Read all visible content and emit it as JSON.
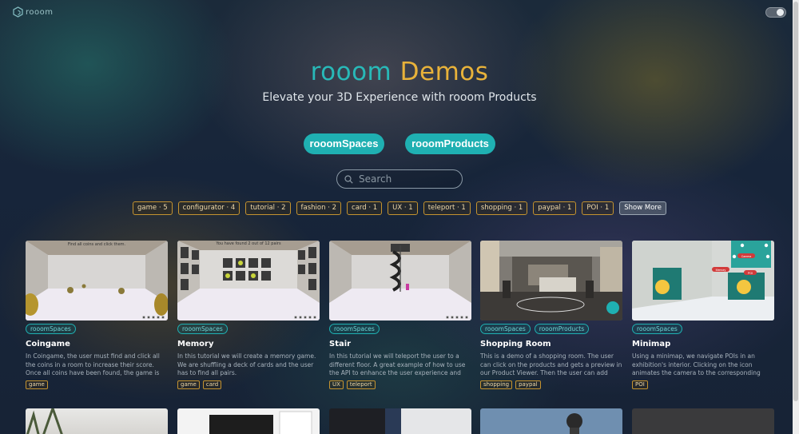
{
  "brand": {
    "logo_text": "rooom",
    "logo_icon": "rooom-cube-icon"
  },
  "theme_toggle": {
    "icon": "moon-icon"
  },
  "hero": {
    "title_part1": "rooom",
    "title_part2": "Demos",
    "subtitle": "Elevate your 3D Experience with rooom Products"
  },
  "categories": [
    {
      "label": "rooomSpaces"
    },
    {
      "label": "rooomProducts"
    }
  ],
  "search": {
    "placeholder": "Search",
    "icon": "search-icon"
  },
  "filter_tags": [
    {
      "label": "game · 5"
    },
    {
      "label": "configurator · 4"
    },
    {
      "label": "tutorial · 2"
    },
    {
      "label": "fashion · 2"
    },
    {
      "label": "card · 1"
    },
    {
      "label": "UX · 1"
    },
    {
      "label": "teleport · 1"
    },
    {
      "label": "shopping · 1"
    },
    {
      "label": "paypal · 1"
    },
    {
      "label": "POI · 1"
    }
  ],
  "show_more_label": "Show More",
  "cards": [
    {
      "title": "Coingame",
      "thumb_caption": "Find all coins and click them.",
      "categories": [
        "rooomSpaces"
      ],
      "description": "In Coingame, the user must find and click all the coins in a room to increase their score. Once all coins have been found, the game is over and the...",
      "tags": [
        "game"
      ]
    },
    {
      "title": "Memory",
      "thumb_caption": "You have found 2 out of 12 pairs",
      "categories": [
        "rooomSpaces"
      ],
      "description": "In this tutorial we will create a memory game. We are shuffling a deck of cards and the user has to find all pairs.",
      "tags": [
        "game",
        "card"
      ]
    },
    {
      "title": "Stair",
      "thumb_caption": "",
      "categories": [
        "rooomSpaces"
      ],
      "description": "In this tutorial we will teleport the user to a different floor. A great example of how to use the API to enhance the user experience and make th...",
      "tags": [
        "UX",
        "teleport"
      ]
    },
    {
      "title": "Shopping Room",
      "thumb_caption": "",
      "categories": [
        "rooomSpaces",
        "rooomProducts"
      ],
      "description": "This is a demo of a shopping room. The user can click on the products and gets a preview in our Product Viewer. Then the user can add the...",
      "tags": [
        "shopping",
        "paypal"
      ]
    },
    {
      "title": "Minimap",
      "thumb_caption": "",
      "map_labels": [
        "Camera",
        "Memory",
        "POI"
      ],
      "categories": [
        "rooomSpaces"
      ],
      "description": "Using a minimap, we navigate POIs in an exhibition's interior. Clicking on the icon animates the camera to the corresponding coordinate. The...",
      "tags": [
        "POI"
      ]
    }
  ]
}
